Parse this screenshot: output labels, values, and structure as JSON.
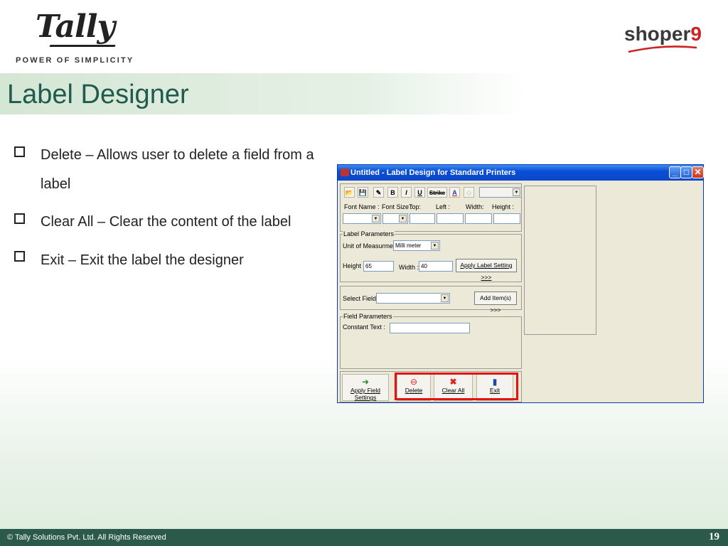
{
  "header": {
    "logo_text": "Tally",
    "tagline": "POWER OF SIMPLICITY",
    "brand_text": "shoper",
    "brand_number": "9"
  },
  "title": "Label Designer",
  "bullets": [
    {
      "text": "Delete – Allows user to delete a field from a label"
    },
    {
      "text": "Clear All – Clear the content of the label"
    },
    {
      "text": "Exit – Exit the label the designer"
    }
  ],
  "dialog": {
    "title": "Untitled - Label Design for Standard Printers",
    "toolbar": {
      "bold": "B",
      "italic": "I",
      "underline": "U",
      "strike": "Strike",
      "font_color": "A"
    },
    "font_row": {
      "font_name": "Font Name :",
      "font_size": "Font Size :",
      "top": "Top:",
      "left": "Left :",
      "width": "Width:",
      "height": "Height :"
    },
    "label_parameters": {
      "legend": "Label Parameters",
      "unit_label": "Unit of Measurment :",
      "unit_value": "Milli meter",
      "height_label": "Height :",
      "height_value": "65",
      "width_label": "Width :",
      "width_value": "40",
      "apply_button": "Apply Label Setting >>>"
    },
    "select_fields": {
      "label": "Select Fields:",
      "add_button": "Add Item(s) >>>"
    },
    "field_parameters": {
      "legend": "Field Parameters",
      "constant_text_label": "Constant Text :"
    },
    "footer_buttons": {
      "apply_field": "Apply Field Settings",
      "delete": "Delete",
      "clear_all": "Clear All",
      "exit": "Exit"
    }
  },
  "footer": {
    "copyright": "© Tally Solutions Pvt. Ltd. All Rights Reserved",
    "page_number": "19"
  },
  "colors": {
    "title": "#215a4e",
    "footer_bg": "#2b5a4a",
    "highlight": "#e21313",
    "brand_accent": "#cc2222"
  }
}
